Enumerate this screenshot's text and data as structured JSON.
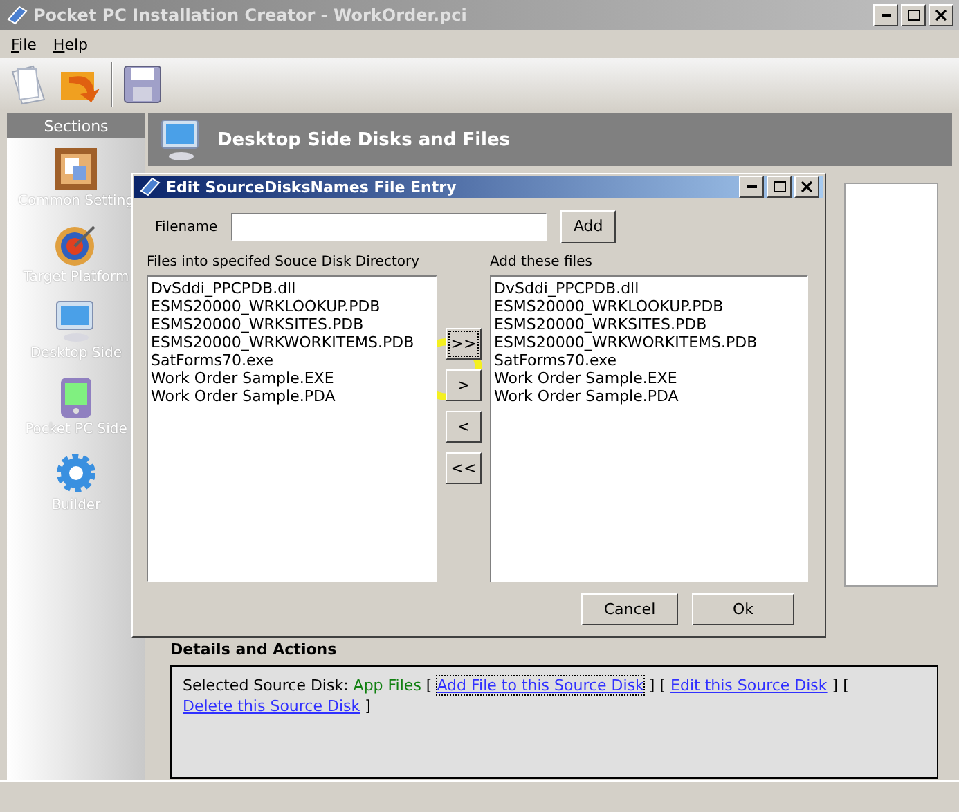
{
  "window": {
    "title": "Pocket PC Installation Creator - WorkOrder.pci"
  },
  "menu": [
    "File",
    "Help"
  ],
  "sidebar": {
    "header": "Sections",
    "items": [
      {
        "label": "Common Setting",
        "kind": "notes"
      },
      {
        "label": "Target Platform",
        "kind": "target"
      },
      {
        "label": "Desktop Side",
        "kind": "monitor"
      },
      {
        "label": "Pocket PC Side",
        "kind": "pda"
      },
      {
        "label": "Builder",
        "kind": "gear"
      }
    ]
  },
  "content": {
    "title": "Desktop Side Disks and Files"
  },
  "details": {
    "title": "Details and Actions",
    "segments": [
      {
        "kind": "text",
        "text": "Selected Source Disk: "
      },
      {
        "kind": "value",
        "text": "App Files"
      },
      {
        "kind": "text",
        "text": " [ "
      },
      {
        "kind": "link",
        "text": "Add File to this Source Disk",
        "focused": true
      },
      {
        "kind": "text",
        "text": " ] [ "
      },
      {
        "kind": "link",
        "text": "Edit this Source Disk",
        "focused": false
      },
      {
        "kind": "text",
        "text": " ] [ "
      },
      {
        "kind": "link",
        "text": "Delete this Source Disk",
        "focused": false
      },
      {
        "kind": "text",
        "text": " ]"
      }
    ]
  },
  "dialog": {
    "title": "Edit SourceDisksNames File Entry",
    "filename_label": "Filename",
    "add_button": "Add",
    "left_label": "Files into specifed Souce Disk Directory",
    "left_files": [
      "DvSddi_PPCPDB.dll",
      "ESMS20000_WRKLOOKUP.PDB",
      "ESMS20000_WRKSITES.PDB",
      "ESMS20000_WRKWORKITEMS.PDB",
      "SatForms70.exe",
      "Work Order Sample.EXE",
      "Work Order Sample.PDA"
    ],
    "move_buttons": [
      {
        "label": ">>",
        "focused": true
      },
      {
        "label": ">",
        "focused": false
      },
      {
        "label": "<",
        "focused": false
      },
      {
        "label": "<<",
        "focused": false
      }
    ],
    "right_label": "Add these files",
    "right_files": [
      "DvSddi_PPCPDB.dll",
      "ESMS20000_WRKLOOKUP.PDB",
      "ESMS20000_WRKSITES.PDB",
      "ESMS20000_WRKWORKITEMS.PDB",
      "SatForms70.exe",
      "Work Order Sample.EXE",
      "Work Order Sample.PDA"
    ],
    "cancel_button": "Cancel",
    "ok_button": "Ok"
  }
}
